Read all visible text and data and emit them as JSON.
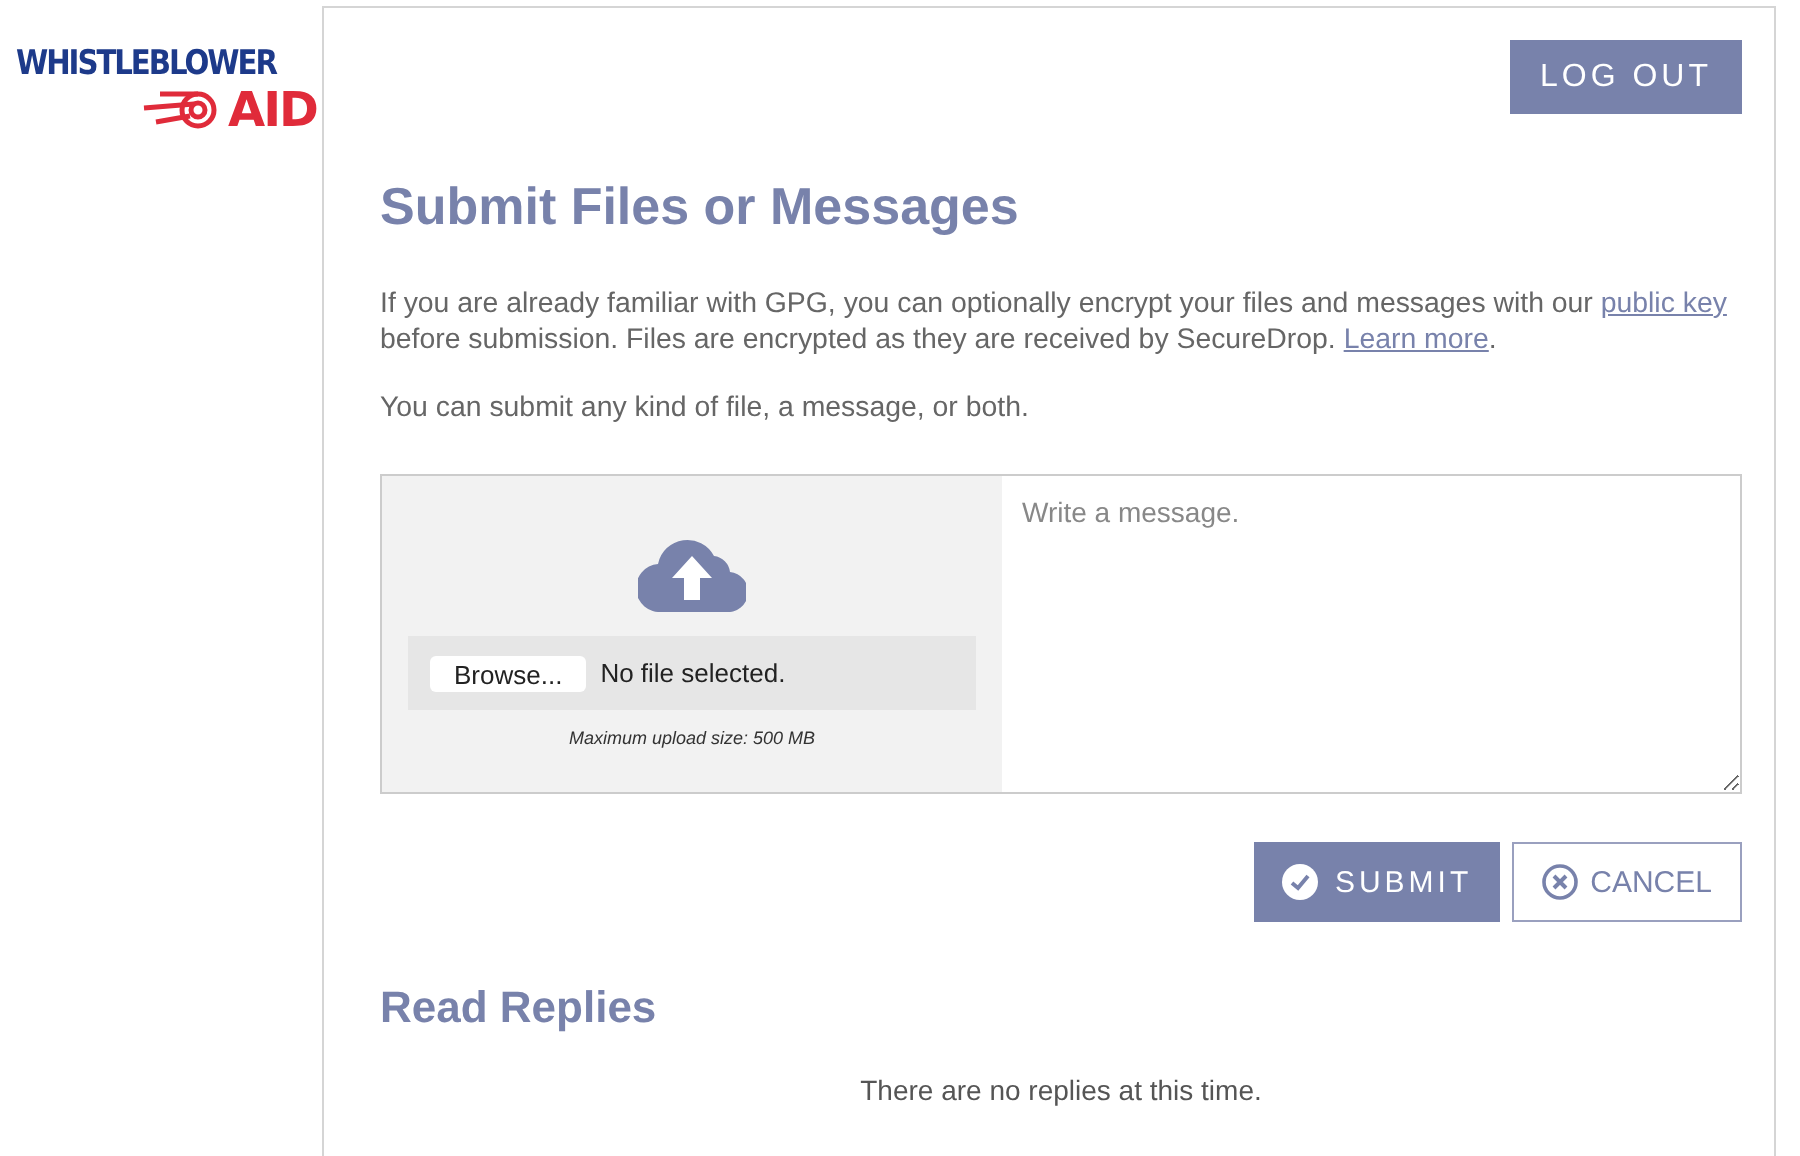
{
  "logo": {
    "line_1": "WHISTLEBLOWER",
    "line_2": "AID"
  },
  "logout_button": "LOG OUT",
  "title": "Submit Files or Messages",
  "intro": [
    {
      "kind": "text",
      "text": "If you are already familiar with GPG, you can optionally encrypt your files and messages with our "
    },
    {
      "kind": "link",
      "text": "public key"
    },
    {
      "kind": "text",
      "text": " before submission. Files are encrypted as they are received by SecureDrop. "
    },
    {
      "kind": "link",
      "text": "Learn more"
    },
    {
      "kind": "text",
      "text": "."
    }
  ],
  "note": "You can submit any kind of file, a message, or both.",
  "upload": {
    "browse_button": "Browse...",
    "file_status": "No file selected.",
    "max_size": "Maximum upload size: 500 MB"
  },
  "message": {
    "placeholder": "Write a message."
  },
  "submit_button": "SUBMIT",
  "cancel_button": "CANCEL",
  "replies": {
    "title": "Read Replies",
    "empty_text": "There are no replies at this time."
  }
}
